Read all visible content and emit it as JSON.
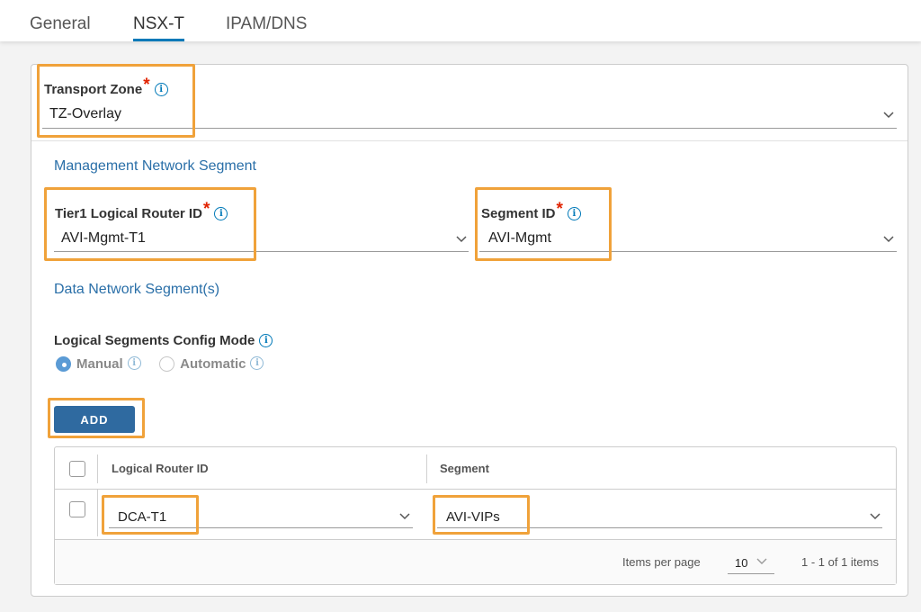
{
  "tabs": [
    {
      "label": "General",
      "active": false
    },
    {
      "label": "NSX-T",
      "active": true
    },
    {
      "label": "IPAM/DNS",
      "active": false
    }
  ],
  "transport_zone": {
    "label": "Transport Zone",
    "required_mark": "*",
    "value": "TZ-Overlay"
  },
  "mgmt_section": {
    "title": "Management Network Segment",
    "tier1": {
      "label": "Tier1 Logical Router ID",
      "required_mark": "*",
      "value": "AVI-Mgmt-T1"
    },
    "segment": {
      "label": "Segment ID",
      "required_mark": "*",
      "value": "AVI-Mgmt"
    }
  },
  "data_section": {
    "title": "Data Network Segment(s)",
    "config_mode": {
      "label": "Logical Segments Config Mode",
      "options": [
        {
          "label": "Manual",
          "selected": true
        },
        {
          "label": "Automatic",
          "selected": false
        }
      ]
    },
    "add_label": "ADD"
  },
  "grid": {
    "columns": [
      "Logical Router ID",
      "Segment"
    ],
    "rows": [
      {
        "router": "DCA-T1",
        "segment": "AVI-VIPs"
      }
    ],
    "footer": {
      "items_per_page_label": "Items per page",
      "page_size": "10",
      "range_text": "1 - 1 of 1 items"
    }
  },
  "icons": {
    "info": "info-icon",
    "dropdown": "chevron-down-icon"
  },
  "colors": {
    "accent": "#0079b8",
    "required": "#e12200",
    "highlight": "#f0a23a",
    "button": "#2f6aa0",
    "section_title": "#2a6fa8"
  }
}
